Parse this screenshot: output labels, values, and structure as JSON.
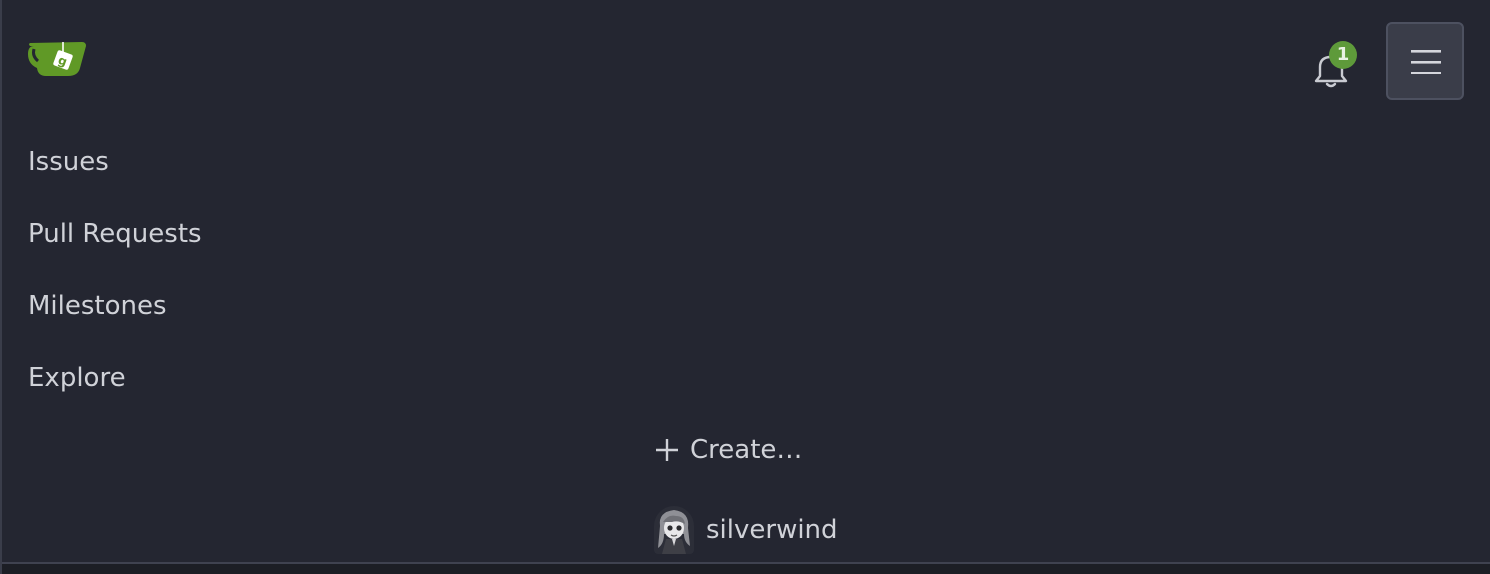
{
  "header": {
    "logo_icon": "gitea-teacup-logo",
    "notifications": {
      "icon": "bell-icon",
      "count": "1",
      "badge_color": "#5e9a3a"
    },
    "menu_toggle_icon": "hamburger-icon"
  },
  "nav": {
    "items": [
      {
        "label": "Issues"
      },
      {
        "label": "Pull Requests"
      },
      {
        "label": "Milestones"
      },
      {
        "label": "Explore"
      }
    ],
    "create": {
      "icon": "plus-icon",
      "label": "Create…"
    },
    "user": {
      "avatar_icon": "user-avatar",
      "name": "silverwind"
    }
  },
  "theme": {
    "background": "#242631",
    "text": "#d0d2d8",
    "brand": "#5e9a3a"
  }
}
